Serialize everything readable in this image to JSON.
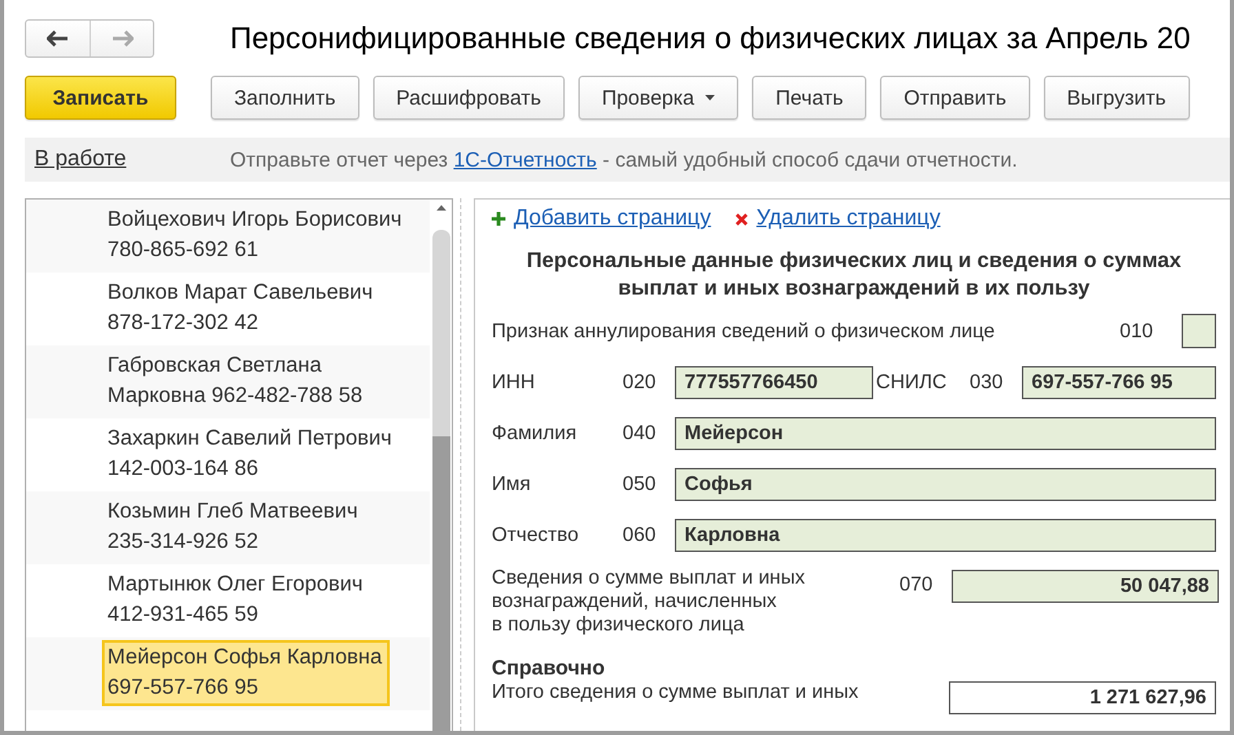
{
  "nav": {
    "back": {
      "disabled": false
    },
    "forward": {
      "disabled": true
    }
  },
  "title": "Персонифицированные сведения о физических лицах за Апрель 20",
  "toolbar": [
    {
      "label": "Записать",
      "kind": "primary"
    },
    {
      "label": "Заполнить",
      "kind": "plain"
    },
    {
      "label": "Расшифровать",
      "kind": "plain"
    },
    {
      "label": "Проверка",
      "kind": "dropdown"
    },
    {
      "label": "Печать",
      "kind": "plain"
    },
    {
      "label": "Отправить",
      "kind": "plain"
    },
    {
      "label": "Выгрузить",
      "kind": "plain"
    }
  ],
  "info_bar": {
    "status": "В работе",
    "notice_before": "Отправьте отчет через ",
    "notice_link": "1С-Отчетность",
    "notice_after": " - самый удобный способ сдачи отчетности."
  },
  "employees": [
    {
      "lines": [
        "Войцехович Игорь Борисович",
        "780-865-692 61"
      ],
      "selected": false
    },
    {
      "lines": [
        "Волков Марат Савельевич",
        "878-172-302 42"
      ],
      "selected": false
    },
    {
      "lines": [
        "Габровская Светлана",
        "Марковна 962-482-788 58"
      ],
      "selected": false
    },
    {
      "lines": [
        "Захаркин Савелий Петрович",
        "142-003-164 86"
      ],
      "selected": false
    },
    {
      "lines": [
        "Козьмин Глеб Матвеевич",
        "235-314-926 52"
      ],
      "selected": false
    },
    {
      "lines": [
        "Мартынюк Олег Егорович",
        "412-931-465 59"
      ],
      "selected": false
    },
    {
      "lines": [
        "Мейерсон Софья Карловна",
        "697-557-766 95"
      ],
      "selected": true
    }
  ],
  "form": {
    "add_page": "Добавить страницу",
    "delete_page": "Удалить страницу",
    "heading": "Персональные данные физических лиц и сведения о суммах выплат и иных вознаграждений в их пользу",
    "rows": [
      {
        "kind": "flag",
        "label": "Признак аннулирования сведений о физическом лице",
        "code": "010",
        "checked": false
      },
      {
        "kind": "pair",
        "fields": [
          {
            "label": "ИНН",
            "code": "020",
            "value": "777557766450"
          },
          {
            "label": "СНИЛС",
            "code": "030",
            "value": "697-557-766 95"
          }
        ]
      },
      {
        "kind": "text",
        "label": "Фамилия",
        "code": "040",
        "value": "Мейерсон"
      },
      {
        "kind": "text",
        "label": "Имя",
        "code": "050",
        "value": "Софья"
      },
      {
        "kind": "text",
        "label": "Отчество",
        "code": "060",
        "value": "Карловна"
      },
      {
        "kind": "amount",
        "lines": [
          "Сведения о сумме выплат и иных",
          "вознаграждений, начисленных",
          "в пользу физического лица"
        ],
        "code": "070",
        "value": "50 047,88"
      },
      {
        "kind": "section",
        "label": "Справочно"
      },
      {
        "kind": "total",
        "label": "Итого сведения о сумме выплат и иных",
        "value": "1 271 627,96"
      }
    ]
  }
}
